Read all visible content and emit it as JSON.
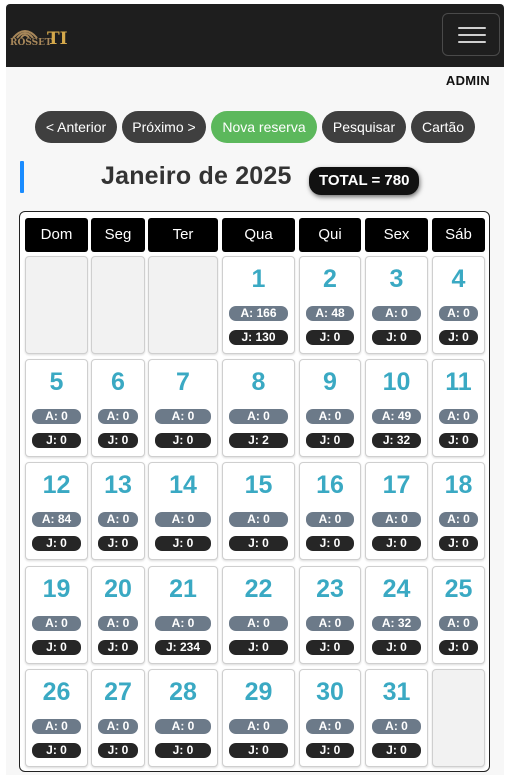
{
  "header": {
    "logo_text": "ROSSET",
    "logo_mark": "TI",
    "logo_small": "CO",
    "menu_icon": "hamburger-menu-icon"
  },
  "user": {
    "role": "ADMIN"
  },
  "buttons": {
    "previous": "< Anterior",
    "next": "Próximo >",
    "new_reservation": "Nova reserva",
    "search": "Pesquisar",
    "card": "Cartão"
  },
  "colors": {
    "new_reservation": "#5cb85c",
    "day_number": "#3aa9c3",
    "title_accent": "#1a8cff"
  },
  "calendar": {
    "title": "Janeiro de 2025",
    "total": "TOTAL = 780",
    "weekdays": [
      "Dom",
      "Seg",
      "Ter",
      "Qua",
      "Qui",
      "Sex",
      "Sáb"
    ],
    "leading_blanks": 3,
    "trailing_blanks": 1,
    "days": [
      {
        "day": "1",
        "a": "A: 166",
        "j": "J: 130"
      },
      {
        "day": "2",
        "a": "A: 48",
        "j": "J: 0"
      },
      {
        "day": "3",
        "a": "A: 0",
        "j": "J: 0"
      },
      {
        "day": "4",
        "a": "A: 0",
        "j": "J: 0"
      },
      {
        "day": "5",
        "a": "A: 0",
        "j": "J: 0"
      },
      {
        "day": "6",
        "a": "A: 0",
        "j": "J: 0"
      },
      {
        "day": "7",
        "a": "A: 0",
        "j": "J: 0"
      },
      {
        "day": "8",
        "a": "A: 0",
        "j": "J: 2"
      },
      {
        "day": "9",
        "a": "A: 0",
        "j": "J: 0"
      },
      {
        "day": "10",
        "a": "A: 49",
        "j": "J: 32"
      },
      {
        "day": "11",
        "a": "A: 0",
        "j": "J: 0"
      },
      {
        "day": "12",
        "a": "A: 84",
        "j": "J: 0"
      },
      {
        "day": "13",
        "a": "A: 0",
        "j": "J: 0"
      },
      {
        "day": "14",
        "a": "A: 0",
        "j": "J: 0"
      },
      {
        "day": "15",
        "a": "A: 0",
        "j": "J: 0"
      },
      {
        "day": "16",
        "a": "A: 0",
        "j": "J: 0"
      },
      {
        "day": "17",
        "a": "A: 0",
        "j": "J: 0"
      },
      {
        "day": "18",
        "a": "A: 0",
        "j": "J: 0"
      },
      {
        "day": "19",
        "a": "A: 0",
        "j": "J: 0"
      },
      {
        "day": "20",
        "a": "A: 0",
        "j": "J: 0"
      },
      {
        "day": "21",
        "a": "A: 0",
        "j": "J: 234"
      },
      {
        "day": "22",
        "a": "A: 0",
        "j": "J: 0"
      },
      {
        "day": "23",
        "a": "A: 0",
        "j": "J: 0"
      },
      {
        "day": "24",
        "a": "A: 32",
        "j": "J: 0"
      },
      {
        "day": "25",
        "a": "A: 0",
        "j": "J: 0"
      },
      {
        "day": "26",
        "a": "A: 0",
        "j": "J: 0"
      },
      {
        "day": "27",
        "a": "A: 0",
        "j": "J: 0"
      },
      {
        "day": "28",
        "a": "A: 0",
        "j": "J: 0"
      },
      {
        "day": "29",
        "a": "A: 0",
        "j": "J: 0"
      },
      {
        "day": "30",
        "a": "A: 0",
        "j": "J: 0"
      },
      {
        "day": "31",
        "a": "A: 0",
        "j": "J: 0"
      }
    ]
  }
}
